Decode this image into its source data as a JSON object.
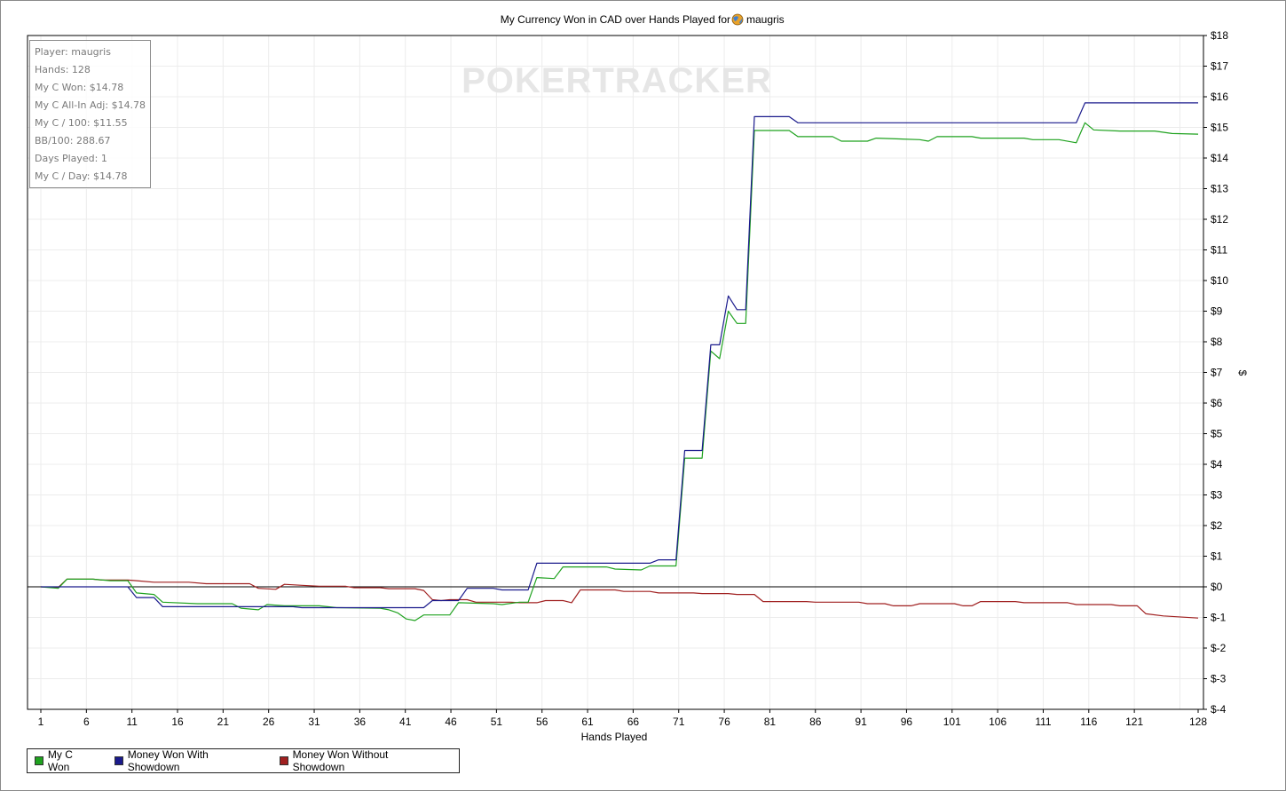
{
  "chart_data": {
    "type": "line",
    "title": "My Currency Won in CAD over Hands Played for",
    "player_name": "maugris",
    "xlabel": "Hands Played",
    "ylabel": "$",
    "xlim": [
      1,
      128
    ],
    "ylim": [
      -4,
      18
    ],
    "x_ticks": [
      "1",
      "6",
      "11",
      "16",
      "21",
      "26",
      "31",
      "36",
      "41",
      "46",
      "51",
      "56",
      "61",
      "66",
      "71",
      "76",
      "81",
      "86",
      "91",
      "96",
      "101",
      "106",
      "111",
      "116",
      "121",
      "128"
    ],
    "y_ticks": [
      "$18",
      "$17",
      "$16",
      "$15",
      "$14",
      "$13",
      "$12",
      "$11",
      "$10",
      "$9",
      "$8",
      "$7",
      "$6",
      "$5",
      "$4",
      "$3",
      "$2",
      "$1",
      "$0",
      "$-1",
      "$-2",
      "$-3",
      "$-4"
    ],
    "grid": true,
    "legend_position": "bottom-left",
    "watermark": "POKERTRACKER",
    "series": [
      {
        "name": "My C Won",
        "color": "#1fa21f",
        "points": [
          [
            1,
            0
          ],
          [
            3,
            -0.05
          ],
          [
            4,
            0.25
          ],
          [
            7,
            0.25
          ],
          [
            9,
            0.2
          ],
          [
            11,
            0.2
          ],
          [
            12,
            -0.2
          ],
          [
            14,
            -0.25
          ],
          [
            15,
            -0.5
          ],
          [
            19,
            -0.55
          ],
          [
            23,
            -0.55
          ],
          [
            24,
            -0.7
          ],
          [
            26,
            -0.75
          ],
          [
            27,
            -0.58
          ],
          [
            29,
            -0.62
          ],
          [
            33,
            -0.62
          ],
          [
            35,
            -0.68
          ],
          [
            40,
            -0.7
          ],
          [
            41,
            -0.75
          ],
          [
            42,
            -0.85
          ],
          [
            43,
            -1.05
          ],
          [
            44,
            -1.1
          ],
          [
            45,
            -0.92
          ],
          [
            48,
            -0.92
          ],
          [
            49,
            -0.52
          ],
          [
            53,
            -0.55
          ],
          [
            54,
            -0.58
          ],
          [
            56,
            -0.5
          ],
          [
            57,
            -0.5
          ],
          [
            58,
            0.3
          ],
          [
            60,
            0.27
          ],
          [
            61,
            0.65
          ],
          [
            66,
            0.65
          ],
          [
            67,
            0.58
          ],
          [
            70,
            0.55
          ],
          [
            71,
            0.68
          ],
          [
            74,
            0.68
          ],
          [
            75,
            4.2
          ],
          [
            77,
            4.2
          ],
          [
            78,
            7.7
          ],
          [
            79,
            7.45
          ],
          [
            80,
            9.0
          ],
          [
            81,
            8.6
          ],
          [
            82,
            8.6
          ],
          [
            83,
            14.9
          ],
          [
            87,
            14.9
          ],
          [
            88,
            14.7
          ],
          [
            92,
            14.7
          ],
          [
            93,
            14.55
          ],
          [
            96,
            14.55
          ],
          [
            97,
            14.65
          ],
          [
            102,
            14.6
          ],
          [
            103,
            14.55
          ],
          [
            104,
            14.7
          ],
          [
            108,
            14.7
          ],
          [
            109,
            14.65
          ],
          [
            114,
            14.65
          ],
          [
            115,
            14.6
          ],
          [
            118,
            14.6
          ],
          [
            120,
            14.5
          ],
          [
            121,
            15.15
          ],
          [
            122,
            14.92
          ],
          [
            125,
            14.88
          ],
          [
            129,
            14.88
          ],
          [
            131,
            14.8
          ],
          [
            134,
            14.78
          ]
        ]
      },
      {
        "name": "Money Won With Showdown",
        "color": "#1a1a8c",
        "points": [
          [
            1,
            0
          ],
          [
            11,
            0
          ],
          [
            12,
            -0.35
          ],
          [
            14,
            -0.35
          ],
          [
            15,
            -0.65
          ],
          [
            30,
            -0.65
          ],
          [
            31,
            -0.68
          ],
          [
            45,
            -0.68
          ],
          [
            46,
            -0.45
          ],
          [
            49,
            -0.45
          ],
          [
            50,
            -0.05
          ],
          [
            53,
            -0.05
          ],
          [
            54,
            -0.1
          ],
          [
            57,
            -0.1
          ],
          [
            58,
            0.77
          ],
          [
            71,
            0.77
          ],
          [
            72,
            0.88
          ],
          [
            74,
            0.88
          ],
          [
            75,
            4.45
          ],
          [
            77,
            4.45
          ],
          [
            78,
            7.9
          ],
          [
            79,
            7.9
          ],
          [
            80,
            9.5
          ],
          [
            81,
            9.05
          ],
          [
            82,
            9.05
          ],
          [
            83,
            15.35
          ],
          [
            87,
            15.35
          ],
          [
            88,
            15.15
          ],
          [
            120,
            15.15
          ],
          [
            121,
            15.8
          ],
          [
            134,
            15.8
          ]
        ]
      },
      {
        "name": "Money Won Without Showdown",
        "color": "#a02020",
        "points": [
          [
            1,
            0
          ],
          [
            3,
            -0.02
          ],
          [
            4,
            0.25
          ],
          [
            7,
            0.25
          ],
          [
            8,
            0.22
          ],
          [
            11,
            0.22
          ],
          [
            12,
            0.2
          ],
          [
            14,
            0.15
          ],
          [
            18,
            0.15
          ],
          [
            20,
            0.1
          ],
          [
            25,
            0.1
          ],
          [
            26,
            -0.05
          ],
          [
            28,
            -0.08
          ],
          [
            29,
            0.08
          ],
          [
            31,
            0.05
          ],
          [
            33,
            0.02
          ],
          [
            36,
            0.02
          ],
          [
            37,
            -0.03
          ],
          [
            40,
            -0.03
          ],
          [
            41,
            -0.06
          ],
          [
            44,
            -0.06
          ],
          [
            45,
            -0.12
          ],
          [
            46,
            -0.42
          ],
          [
            47,
            -0.45
          ],
          [
            48,
            -0.42
          ],
          [
            50,
            -0.42
          ],
          [
            51,
            -0.5
          ],
          [
            55,
            -0.5
          ],
          [
            56,
            -0.52
          ],
          [
            58,
            -0.52
          ],
          [
            59,
            -0.45
          ],
          [
            61,
            -0.45
          ],
          [
            62,
            -0.52
          ],
          [
            63,
            -0.1
          ],
          [
            67,
            -0.1
          ],
          [
            68,
            -0.15
          ],
          [
            71,
            -0.15
          ],
          [
            72,
            -0.2
          ],
          [
            76,
            -0.2
          ],
          [
            77,
            -0.22
          ],
          [
            80,
            -0.22
          ],
          [
            81,
            -0.25
          ],
          [
            83,
            -0.25
          ],
          [
            84,
            -0.48
          ],
          [
            89,
            -0.48
          ],
          [
            90,
            -0.5
          ],
          [
            95,
            -0.5
          ],
          [
            96,
            -0.55
          ],
          [
            98,
            -0.55
          ],
          [
            99,
            -0.62
          ],
          [
            101,
            -0.62
          ],
          [
            102,
            -0.55
          ],
          [
            106,
            -0.55
          ],
          [
            107,
            -0.62
          ],
          [
            108,
            -0.62
          ],
          [
            109,
            -0.48
          ],
          [
            113,
            -0.48
          ],
          [
            114,
            -0.52
          ],
          [
            119,
            -0.52
          ],
          [
            120,
            -0.58
          ],
          [
            124,
            -0.58
          ],
          [
            125,
            -0.62
          ],
          [
            127,
            -0.62
          ],
          [
            128,
            -0.88
          ],
          [
            130,
            -0.95
          ],
          [
            134,
            -1.02
          ]
        ]
      }
    ]
  },
  "stats": {
    "lines": [
      "Player: maugris",
      "Hands: 128",
      "My C Won: $14.78",
      "My C All-In Adj: $14.78",
      "My C / 100: $11.55",
      "BB/100: 288.67",
      "Days Played: 1",
      "My C / Day: $14.78"
    ]
  },
  "legend": {
    "items": [
      {
        "label": "My C Won",
        "color": "#1fa21f"
      },
      {
        "label": "Money Won With Showdown",
        "color": "#1a1a8c"
      },
      {
        "label": "Money Won Without Showdown",
        "color": "#a02020"
      }
    ]
  }
}
